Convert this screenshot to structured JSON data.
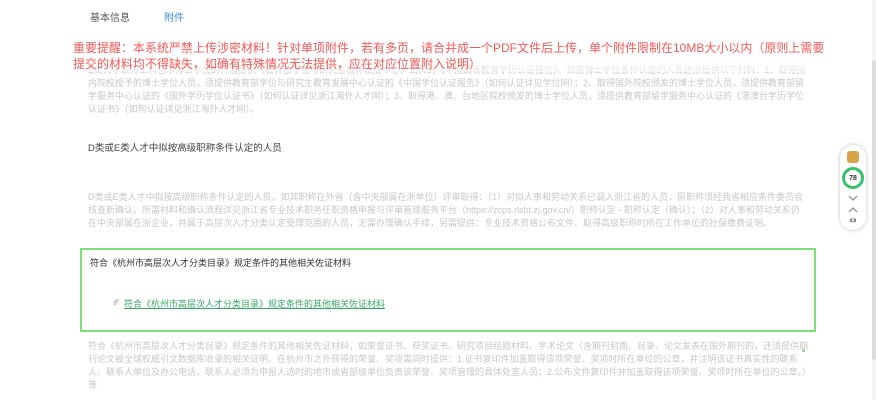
{
  "tabs": {
    "basic": "基本信息",
    "attachment": "附件"
  },
  "warning": "重要提醒：本系统严禁上传涉密材料！针对单项附件，若有多页，请合并成一个PDF文件后上传，单个附件限制在10MB大小以内（原则上需要提交的材料均不得缺失，如确有特殊情况无法提供，应在对应位置附入说明）",
  "block1": "E类对于取得工科艺术博士学位的，需提供《教育部学位与研究生教育发展中心》出具的《中国高等教育学历认证报告》。拟按博士学位条件认定的人员还须提供以下材料：1、取得国内院校授予的博士学位人员，须提供教育部学位与研究生教育发展中心认证的《中国学位认证报告》（如何认证详见学位网）；2、取得国外院校颁发的博士学位人员，须提供教育部留学服务中心认证的《国外学历学位认证书》（如何认证详见浙江海外人才网）；3、取得港、澳、台地区院校颁发的博士学位人员，须提供教育部留学服务中心认证的《港澳台学历学位认证书》（如何认证详见浙江海外人才网）。",
  "category_d": "D类或E类人才中拟按高级职称条件认定的人员",
  "block2": "D类或E类人才中拟按高级职称条件认定的人员，如其职称在外省（含中央部属在浙单位）评审取得：（1）对拟人事和劳动关系已调入浙江省的人员，原职称须经我省相应条件委员会核查新确认。所需材料和确认流程详见浙江省专业技术职务任职资格申报与评审管理服务平台（https://zcps.rlsbt.zj.gov.cn/）职称认定 - 职称认定（确认）；（2）对人事和劳动关系仍在中央部属在浙企业，并属于高层次人才分类认定受理范围的人员，无需办理确认手续，另需提供：专业技术资格公布文件、取得高级职称时所在工作单位的社保缴费证明。",
  "greenbox": {
    "title": "符合《杭州市高层次人才分类目录》规定条件的其他相关佐证材料",
    "link": "符合《杭州市高层次人才分类目录》规定条件的其他相关佐证材料"
  },
  "block3": "符合《杭州市高层次人才分类目录》规定条件的其他相关佐证材料，如荣誉证书、获奖证书、研究项目结题材料、学术论文（含期刊封面、目录、论文发表在国外期刊的，还须提供期刊论文被全球权威引文数据库收录的相关证明。在杭州市之外获得的荣誉、奖项需同时提供：1.证书复印件加盖取得该项荣誉、奖项时所在单位的公章，并注明该证书真实性的联系人、联系人单位及办公电话，联系人必须为申报人选时的地市或省部级单位负责该荣誉、奖项管理的具体处室人员；2.公布文件复印件并加盖取得该项荣誉、奖项时所在单位的公章。）等",
  "widget": {
    "score": "78"
  },
  "colors": {
    "accent": "#3a8ee6",
    "warning": "#f25a5a",
    "highlight_border": "#7ee07a",
    "link": "#3aa76d"
  }
}
